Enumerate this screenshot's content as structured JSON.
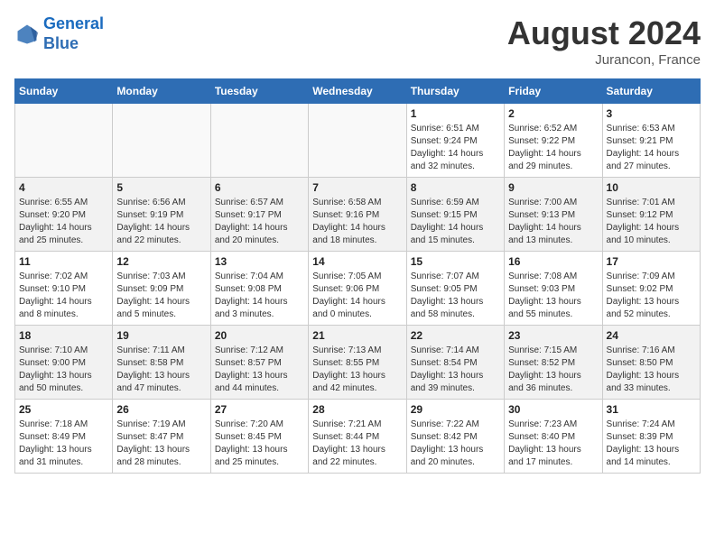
{
  "logo": {
    "line1": "General",
    "line2": "Blue"
  },
  "title": "August 2024",
  "subtitle": "Jurancon, France",
  "days_of_week": [
    "Sunday",
    "Monday",
    "Tuesday",
    "Wednesday",
    "Thursday",
    "Friday",
    "Saturday"
  ],
  "weeks": [
    [
      {
        "day": "",
        "info": ""
      },
      {
        "day": "",
        "info": ""
      },
      {
        "day": "",
        "info": ""
      },
      {
        "day": "",
        "info": ""
      },
      {
        "day": "1",
        "info": "Sunrise: 6:51 AM\nSunset: 9:24 PM\nDaylight: 14 hours\nand 32 minutes."
      },
      {
        "day": "2",
        "info": "Sunrise: 6:52 AM\nSunset: 9:22 PM\nDaylight: 14 hours\nand 29 minutes."
      },
      {
        "day": "3",
        "info": "Sunrise: 6:53 AM\nSunset: 9:21 PM\nDaylight: 14 hours\nand 27 minutes."
      }
    ],
    [
      {
        "day": "4",
        "info": "Sunrise: 6:55 AM\nSunset: 9:20 PM\nDaylight: 14 hours\nand 25 minutes."
      },
      {
        "day": "5",
        "info": "Sunrise: 6:56 AM\nSunset: 9:19 PM\nDaylight: 14 hours\nand 22 minutes."
      },
      {
        "day": "6",
        "info": "Sunrise: 6:57 AM\nSunset: 9:17 PM\nDaylight: 14 hours\nand 20 minutes."
      },
      {
        "day": "7",
        "info": "Sunrise: 6:58 AM\nSunset: 9:16 PM\nDaylight: 14 hours\nand 18 minutes."
      },
      {
        "day": "8",
        "info": "Sunrise: 6:59 AM\nSunset: 9:15 PM\nDaylight: 14 hours\nand 15 minutes."
      },
      {
        "day": "9",
        "info": "Sunrise: 7:00 AM\nSunset: 9:13 PM\nDaylight: 14 hours\nand 13 minutes."
      },
      {
        "day": "10",
        "info": "Sunrise: 7:01 AM\nSunset: 9:12 PM\nDaylight: 14 hours\nand 10 minutes."
      }
    ],
    [
      {
        "day": "11",
        "info": "Sunrise: 7:02 AM\nSunset: 9:10 PM\nDaylight: 14 hours\nand 8 minutes."
      },
      {
        "day": "12",
        "info": "Sunrise: 7:03 AM\nSunset: 9:09 PM\nDaylight: 14 hours\nand 5 minutes."
      },
      {
        "day": "13",
        "info": "Sunrise: 7:04 AM\nSunset: 9:08 PM\nDaylight: 14 hours\nand 3 minutes."
      },
      {
        "day": "14",
        "info": "Sunrise: 7:05 AM\nSunset: 9:06 PM\nDaylight: 14 hours\nand 0 minutes."
      },
      {
        "day": "15",
        "info": "Sunrise: 7:07 AM\nSunset: 9:05 PM\nDaylight: 13 hours\nand 58 minutes."
      },
      {
        "day": "16",
        "info": "Sunrise: 7:08 AM\nSunset: 9:03 PM\nDaylight: 13 hours\nand 55 minutes."
      },
      {
        "day": "17",
        "info": "Sunrise: 7:09 AM\nSunset: 9:02 PM\nDaylight: 13 hours\nand 52 minutes."
      }
    ],
    [
      {
        "day": "18",
        "info": "Sunrise: 7:10 AM\nSunset: 9:00 PM\nDaylight: 13 hours\nand 50 minutes."
      },
      {
        "day": "19",
        "info": "Sunrise: 7:11 AM\nSunset: 8:58 PM\nDaylight: 13 hours\nand 47 minutes."
      },
      {
        "day": "20",
        "info": "Sunrise: 7:12 AM\nSunset: 8:57 PM\nDaylight: 13 hours\nand 44 minutes."
      },
      {
        "day": "21",
        "info": "Sunrise: 7:13 AM\nSunset: 8:55 PM\nDaylight: 13 hours\nand 42 minutes."
      },
      {
        "day": "22",
        "info": "Sunrise: 7:14 AM\nSunset: 8:54 PM\nDaylight: 13 hours\nand 39 minutes."
      },
      {
        "day": "23",
        "info": "Sunrise: 7:15 AM\nSunset: 8:52 PM\nDaylight: 13 hours\nand 36 minutes."
      },
      {
        "day": "24",
        "info": "Sunrise: 7:16 AM\nSunset: 8:50 PM\nDaylight: 13 hours\nand 33 minutes."
      }
    ],
    [
      {
        "day": "25",
        "info": "Sunrise: 7:18 AM\nSunset: 8:49 PM\nDaylight: 13 hours\nand 31 minutes."
      },
      {
        "day": "26",
        "info": "Sunrise: 7:19 AM\nSunset: 8:47 PM\nDaylight: 13 hours\nand 28 minutes."
      },
      {
        "day": "27",
        "info": "Sunrise: 7:20 AM\nSunset: 8:45 PM\nDaylight: 13 hours\nand 25 minutes."
      },
      {
        "day": "28",
        "info": "Sunrise: 7:21 AM\nSunset: 8:44 PM\nDaylight: 13 hours\nand 22 minutes."
      },
      {
        "day": "29",
        "info": "Sunrise: 7:22 AM\nSunset: 8:42 PM\nDaylight: 13 hours\nand 20 minutes."
      },
      {
        "day": "30",
        "info": "Sunrise: 7:23 AM\nSunset: 8:40 PM\nDaylight: 13 hours\nand 17 minutes."
      },
      {
        "day": "31",
        "info": "Sunrise: 7:24 AM\nSunset: 8:39 PM\nDaylight: 13 hours\nand 14 minutes."
      }
    ]
  ]
}
